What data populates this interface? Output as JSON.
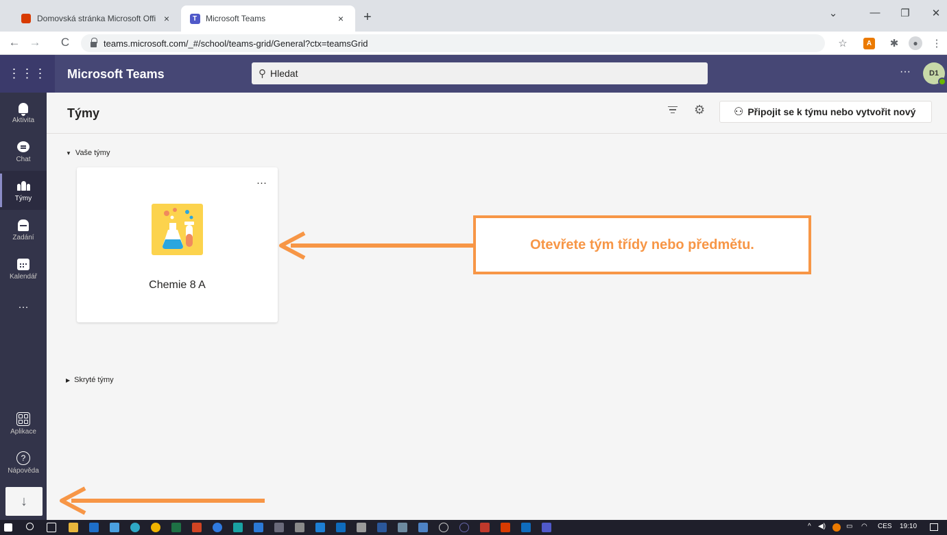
{
  "browser": {
    "tabs": [
      {
        "title": "Domovská stránka Microsoft Offi",
        "icon": "office-icon",
        "active": false
      },
      {
        "title": "Microsoft Teams",
        "icon": "teams-icon",
        "active": true
      }
    ],
    "tab_close_glyph": "×",
    "new_tab_glyph": "+",
    "url": "teams.microsoft.com/_#/school/teams-grid/General?ctx=teamsGrid",
    "window_controls": {
      "chevron": "⌄",
      "minimize": "—",
      "maximize": "❐",
      "close": "✕"
    },
    "nav": {
      "back": "←",
      "forward": "→",
      "reload": "C"
    },
    "extensions": {
      "bookmark": "☆",
      "office": "A",
      "puzzle": "✱",
      "profile": "●",
      "menu": "⋮"
    }
  },
  "teams": {
    "app_title": "Microsoft Teams",
    "waffle_glyph": "⋮⋮⋮",
    "search": {
      "placeholder": "Hledat",
      "icon": "search-icon",
      "glyph": "⚲"
    },
    "header_more": "···",
    "avatar": {
      "initials": "D1",
      "status_color": "#6bb700"
    },
    "rail": [
      {
        "label": "Aktivita",
        "icon": "bell-icon",
        "active": false
      },
      {
        "label": "Chat",
        "icon": "chat-icon",
        "active": false
      },
      {
        "label": "Týmy",
        "icon": "teams-icon",
        "active": true
      },
      {
        "label": "Zadání",
        "icon": "assignments-icon",
        "active": false
      },
      {
        "label": "Kalendář",
        "icon": "calendar-icon",
        "active": false
      }
    ],
    "rail_more": "···",
    "rail_bottom": [
      {
        "label": "Aplikace",
        "icon": "apps-icon"
      },
      {
        "label": "Nápověda",
        "icon": "help-icon",
        "glyph": "?"
      }
    ],
    "download_glyph": "↓",
    "page_title": "Týmy",
    "settings_glyph": "⚙",
    "join_button": {
      "label": "Připojit se k týmu nebo vytvořit nový",
      "icon": "join-team-icon",
      "glyph": "⚇"
    },
    "sections": {
      "your_teams": "Vaše týmy",
      "hidden_teams": "Skryté týmy"
    },
    "team_cards": [
      {
        "name": "Chemie 8 A",
        "more": "···",
        "icon": "chemistry-flask-icon"
      }
    ]
  },
  "annotations": {
    "callout_text": "Otevřete tým třídy nebo předmětu.",
    "accent_color": "#f79646"
  },
  "taskbar": {
    "tray": {
      "lang": "CES",
      "time": "19:10",
      "caret": "^"
    }
  },
  "colors": {
    "teams_header": "#464775",
    "rail": "#33344a",
    "accent": "#f79646"
  }
}
